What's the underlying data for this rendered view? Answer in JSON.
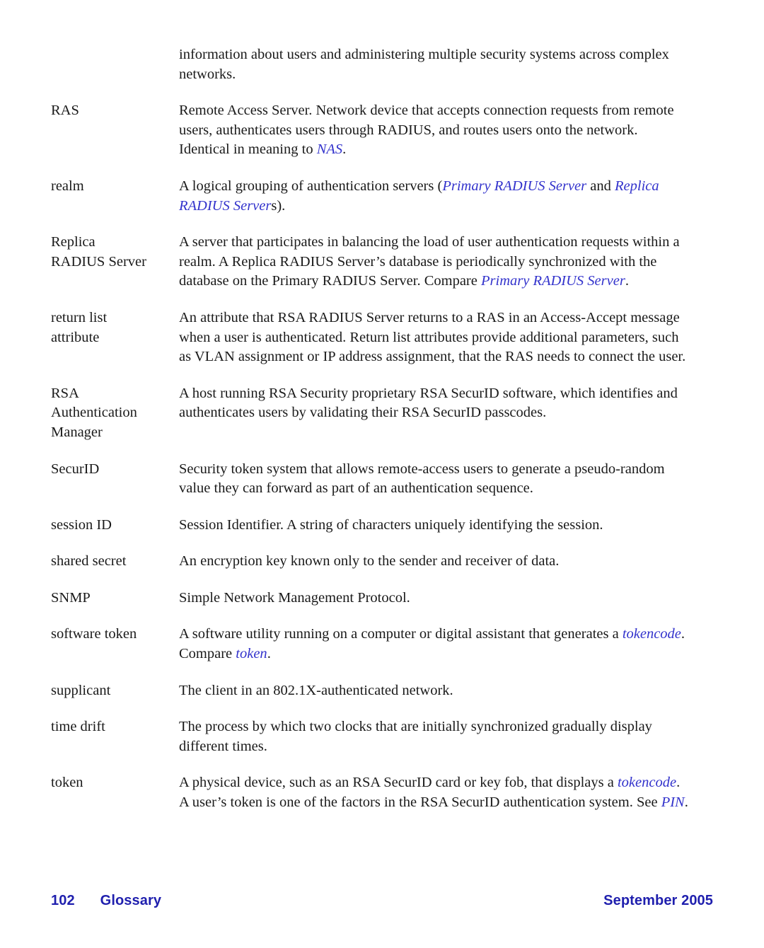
{
  "document": {
    "type": "glossary-page",
    "page_number": "102",
    "section_title": "Glossary",
    "date": "September 2005",
    "link_color": "#3333cc",
    "footer_color": "#1f1fae",
    "text_color": "#1a1a1a"
  },
  "entries": [
    {
      "term": "",
      "definition_runs": [
        {
          "text": "information about users and administering multiple security systems across complex networks.",
          "style": "normal"
        }
      ]
    },
    {
      "term": "RAS",
      "definition_runs": [
        {
          "text": "Remote Access Server. Network device that accepts connection requests from remote users, authenticates users through RADIUS, and routes users onto the network. Identical in meaning to ",
          "style": "normal"
        },
        {
          "text": "NAS",
          "style": "xref"
        },
        {
          "text": ".",
          "style": "normal"
        }
      ]
    },
    {
      "term": "realm",
      "definition_runs": [
        {
          "text": "A logical grouping of authentication servers (",
          "style": "normal"
        },
        {
          "text": "Primary RADIUS Server",
          "style": "xref"
        },
        {
          "text": " and ",
          "style": "normal"
        },
        {
          "text": "Replica RADIUS Server",
          "style": "xref"
        },
        {
          "text": "s).",
          "style": "normal"
        }
      ]
    },
    {
      "term": "Replica\nRADIUS Server",
      "definition_runs": [
        {
          "text": "A server that participates in balancing the load of user authentication requests within a realm. A Replica RADIUS Server’s database is periodically synchronized with the database on the Primary RADIUS Server. Compare ",
          "style": "normal"
        },
        {
          "text": "Primary RADIUS Server",
          "style": "xref"
        },
        {
          "text": ".",
          "style": "normal"
        }
      ]
    },
    {
      "term": "return list\nattribute",
      "definition_runs": [
        {
          "text": "An attribute that RSA RADIUS Server returns to a RAS in an Access-Accept message when a user is authenticated. Return list attributes provide additional parameters, such as VLAN assignment or IP address assignment, that the RAS needs to connect the user.",
          "style": "normal"
        }
      ]
    },
    {
      "term": "RSA\nAuthentication\nManager",
      "definition_runs": [
        {
          "text": "A host running RSA Security proprietary RSA SecurID software, which identifies and authenticates users by validating their RSA SecurID passcodes.",
          "style": "normal"
        }
      ]
    },
    {
      "term": "SecurID",
      "definition_runs": [
        {
          "text": "Security token system that allows remote-access users to generate a pseudo-random value they can forward as part of an authentication sequence.",
          "style": "normal"
        }
      ]
    },
    {
      "term": "session ID",
      "definition_runs": [
        {
          "text": "Session Identifier. A string of characters uniquely identifying the session.",
          "style": "normal"
        }
      ]
    },
    {
      "term": "shared secret",
      "definition_runs": [
        {
          "text": "An encryption key known only to the sender and receiver of data.",
          "style": "normal"
        }
      ]
    },
    {
      "term": "SNMP",
      "definition_runs": [
        {
          "text": "Simple Network Management Protocol.",
          "style": "normal"
        }
      ]
    },
    {
      "term": "software token",
      "definition_runs": [
        {
          "text": "A software utility running on a computer or digital assistant that generates a ",
          "style": "normal"
        },
        {
          "text": "tokencode",
          "style": "xref"
        },
        {
          "text": ". Compare ",
          "style": "normal"
        },
        {
          "text": "token",
          "style": "xref"
        },
        {
          "text": ".",
          "style": "normal"
        }
      ]
    },
    {
      "term": "supplicant",
      "definition_runs": [
        {
          "text": "The client in an 802.1X-authenticated network.",
          "style": "normal"
        }
      ]
    },
    {
      "term": "time drift",
      "definition_runs": [
        {
          "text": "The process by which two clocks that are initially synchronized gradually display different times.",
          "style": "normal"
        }
      ]
    },
    {
      "term": "token",
      "definition_runs": [
        {
          "text": "A physical device, such as an RSA SecurID card or key fob, that displays a ",
          "style": "normal"
        },
        {
          "text": "tokencode",
          "style": "xref"
        },
        {
          "text": ". A user’s token is one of the factors in the RSA SecurID authentication system. See ",
          "style": "normal"
        },
        {
          "text": "PIN",
          "style": "xref"
        },
        {
          "text": ".",
          "style": "normal"
        }
      ]
    }
  ],
  "footer": {
    "page_number": "102",
    "section": "Glossary",
    "date": "September 2005"
  }
}
